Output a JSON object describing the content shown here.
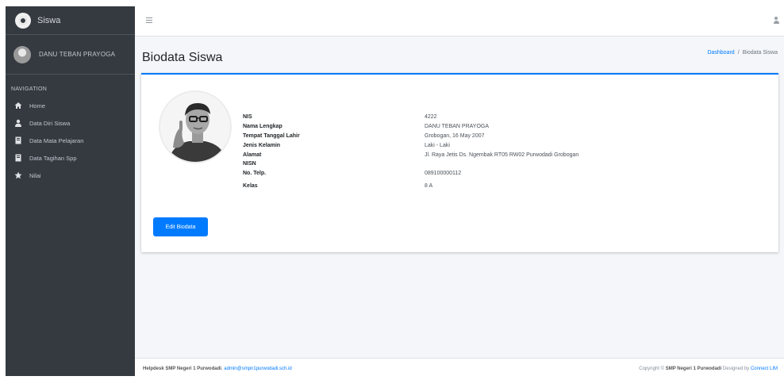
{
  "brand": {
    "name": "Siswa"
  },
  "user": {
    "name": "DANU TEBAN PRAYOGA"
  },
  "sidebar": {
    "header": "NAVIGATION",
    "items": [
      {
        "label": "Home",
        "icon": "home-icon"
      },
      {
        "label": "Data Diri Siswa",
        "icon": "user-icon"
      },
      {
        "label": "Data Mata Pelajaran",
        "icon": "book-icon"
      },
      {
        "label": "Data Tagihan Spp",
        "icon": "book-icon"
      },
      {
        "label": "Nilai",
        "icon": "star-icon"
      }
    ]
  },
  "page": {
    "title": "Biodata Siswa",
    "breadcrumb": {
      "home": "Dashboard",
      "separator": "/",
      "current": "Biodata Siswa"
    }
  },
  "biodata": {
    "rows": [
      {
        "label": "NIS",
        "value": "4222"
      },
      {
        "label": "Nama Lengkap",
        "value": "DANU TEBAN PRAYOGA"
      },
      {
        "label": "Tempat Tanggal Lahir",
        "value": "Grobogan, 16 May 2007"
      },
      {
        "label": "Jenis Kelamin",
        "value": "Laki - Laki"
      },
      {
        "label": "Alamat",
        "value": "Jl. Raya Jetis Ds. Ngembak RT05 RW02 Purwodadi Grobogan"
      },
      {
        "label": "NISN",
        "value": ""
      },
      {
        "label": "No. Telp.",
        "value": "089100000112"
      },
      {
        "label": "Kelas",
        "value": "8 A"
      }
    ],
    "edit_label": "Edit Biodata"
  },
  "footer": {
    "left_bold": "Helpdesk SMP Negeri 1 Purwodadi",
    "left_sep": ", ",
    "left_email": "admin@smpn1purwodadi.sch.id",
    "right_pre": "Copyright © ",
    "right_bold": "SMP Negeri 1 Purwodadi",
    "right_mid": " Designed by ",
    "right_link": "Connect LIM"
  },
  "colors": {
    "sidebar": "#343a40",
    "accent": "#007bff",
    "content_bg": "#f4f6f9"
  }
}
